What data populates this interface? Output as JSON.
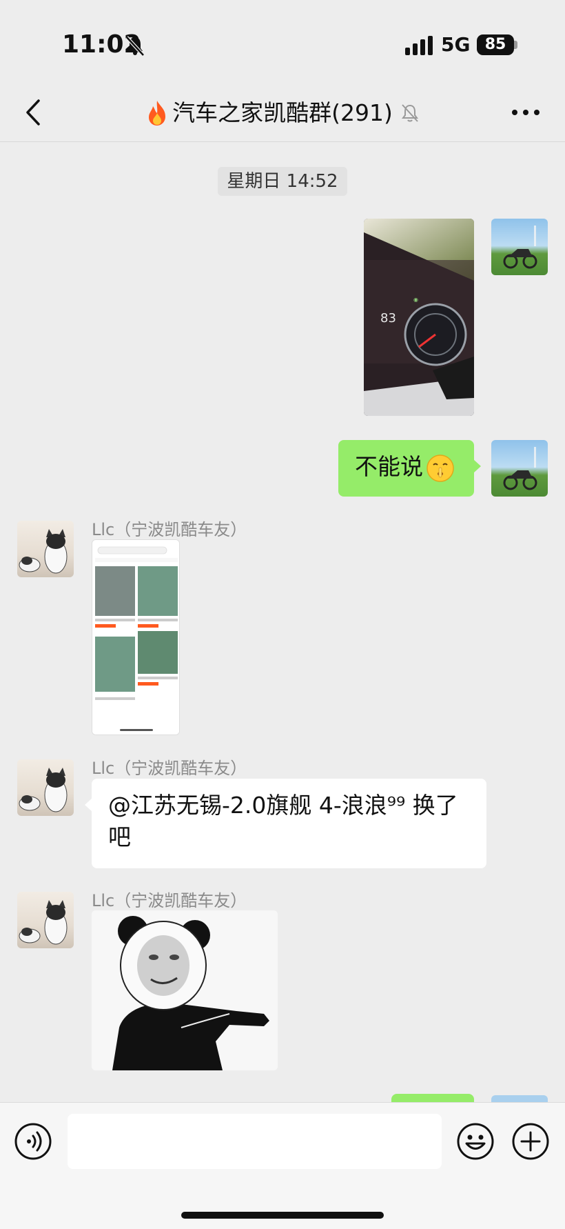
{
  "status_bar": {
    "time": "11:02",
    "network": "5G",
    "battery": "85"
  },
  "header": {
    "title": "汽车之家凯酷群(291)",
    "icons": [
      "back-icon",
      "flame-icon",
      "mute-bell-icon",
      "more-icon"
    ]
  },
  "chat": {
    "timestamp": "星期日 14:52",
    "messages": [
      {
        "from": "self",
        "type": "image",
        "content": "car-dashboard-photo"
      },
      {
        "from": "self",
        "type": "text",
        "text": "不能说",
        "emoji": "hush-emoji"
      },
      {
        "from": "other",
        "sender": "Llc（宁波凯酷车友）",
        "type": "image",
        "content": "shopping-app-screenshot"
      },
      {
        "from": "other",
        "sender": "Llc（宁波凯酷车友）",
        "type": "text",
        "line1": "@江苏无锡-2.0旗舰 4-浪浪⁹⁹ 换了",
        "line2": "吧"
      },
      {
        "from": "other",
        "sender": "Llc（宁波凯酷车友）",
        "type": "image",
        "content": "panda-meme-sticker"
      }
    ]
  },
  "input_bar": {
    "placeholder": "",
    "icons": [
      "voice-icon",
      "emoji-icon",
      "plus-icon"
    ]
  },
  "colors": {
    "background": "#ededed",
    "self_bubble": "#95ec69",
    "other_bubble": "#ffffff",
    "input_bar": "#f6f6f6"
  }
}
